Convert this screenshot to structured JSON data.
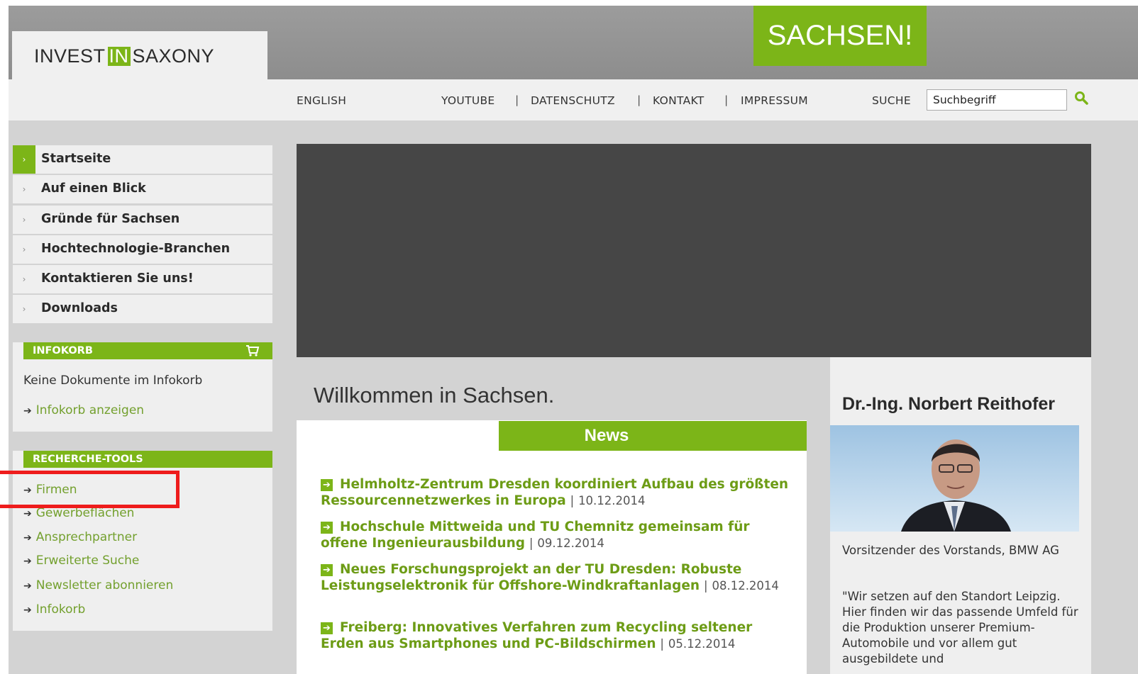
{
  "header": {
    "logo": {
      "part1": "INVEST",
      "part2": "IN",
      "part3": "SAXONY"
    },
    "brand": "SACHSEN!",
    "links": {
      "english": "ENGLISH",
      "youtube": "YOUTUBE",
      "datenschutz": "DATENSCHUTZ",
      "kontakt": "KONTAKT",
      "impressum": "IMPRESSUM",
      "separator": "|"
    },
    "search": {
      "label": "SUCHE",
      "value": "Suchbegriff"
    }
  },
  "sidebar": {
    "nav": [
      {
        "label": "Startseite",
        "active": true
      },
      {
        "label": "Auf einen Blick"
      },
      {
        "label": "Gründe für Sachsen"
      },
      {
        "label": "Hochtechnologie-Branchen"
      },
      {
        "label": "Kontaktieren Sie uns!"
      },
      {
        "label": "Downloads"
      }
    ],
    "infokorb": {
      "title": "INFOKORB",
      "empty_text": "Keine Dokumente im Infokorb",
      "show_link": "Infokorb anzeigen"
    },
    "recherche": {
      "title": "RECHERCHE-TOOLS",
      "links": [
        "Firmen",
        "Gewerbeflächen",
        "Ansprechpartner",
        "Erweiterte Suche",
        "Newsletter abonnieren",
        "Infokorb"
      ]
    }
  },
  "main": {
    "welcome": "Willkommen in Sachsen.",
    "news_title": "News",
    "news": [
      {
        "title": "Helmholtz-Zentrum Dresden koordiniert Aufbau des größten Ressourcennetzwerkes in Europa",
        "date": "10.12.2014"
      },
      {
        "title": "Hochschule Mittweida und TU Chemnitz gemeinsam für offene Ingenieurausbildung",
        "date": "09.12.2014"
      },
      {
        "title": "Neues Forschungsprojekt an der TU Dresden: Robuste Leistungselektronik für Offshore-Windkraftanlagen",
        "date": "08.12.2014"
      },
      {
        "title": "Freiberg: Innovatives Verfahren zum Recycling seltener Erden aus Smartphones und PC-Bildschirmen",
        "date": "05.12.2014"
      }
    ],
    "quote": {
      "name": "Dr.-Ing. Norbert Reithofer",
      "role": "Vorsitzender des Vorstands, BMW AG",
      "text": "\"Wir setzen auf den Standort Leipzig. Hier finden wir das passende Umfeld für die Produktion unserer Premium-Automobile und vor allem gut ausgebildete und"
    }
  },
  "colors": {
    "accent": "#7cb518",
    "highlight": "#ee1c1c",
    "hero": "#464646"
  }
}
